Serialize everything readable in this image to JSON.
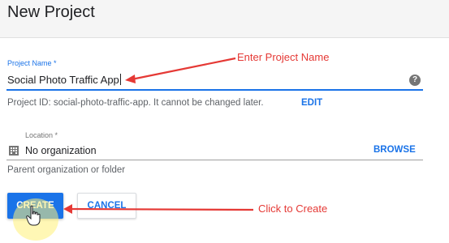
{
  "header": {
    "title": "New Project"
  },
  "project_name": {
    "label": "Project Name *",
    "value": "Social Photo Traffic App",
    "help_icon": "help-circle-icon"
  },
  "project_id": {
    "text": "Project ID: social-photo-traffic-app. It cannot be changed later.",
    "edit_label": "EDIT"
  },
  "location": {
    "label": "Location *",
    "icon": "building-icon",
    "value": "No organization",
    "browse_label": "BROWSE",
    "helper": "Parent organization or folder"
  },
  "actions": {
    "create_label": "CREATE",
    "cancel_label": "CANCEL"
  },
  "annotations": {
    "enter_name": "Enter Project Name",
    "click_create": "Click to Create",
    "color": "#e53935"
  },
  "colors": {
    "accent": "#1a73e8",
    "header_bg": "#f5f5f5"
  }
}
